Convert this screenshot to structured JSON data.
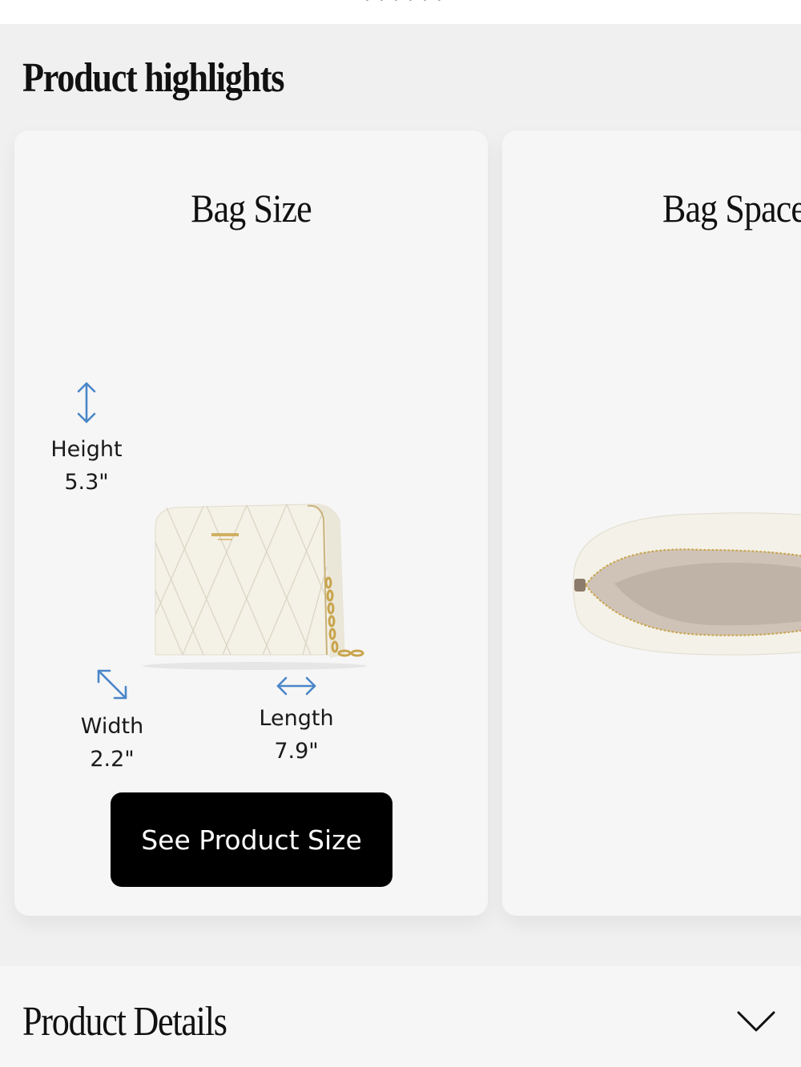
{
  "top_strip": {
    "cut_text": "· · · · · ·"
  },
  "highlights": {
    "title": "Product highlights",
    "cards": [
      {
        "title": "Bag Size",
        "height_label": "Height",
        "height_value": "5.3\"",
        "width_label": "Width",
        "width_value": "2.2\"",
        "length_label": "Length",
        "length_value": "7.9\"",
        "button_label": "See Product Size"
      },
      {
        "title": "Bag Space"
      }
    ]
  },
  "details": {
    "title": "Product Details"
  },
  "icons": {
    "height": "vertical-arrow-icon",
    "width": "diagonal-arrow-icon",
    "length": "horizontal-arrow-icon",
    "expand": "chevron-down-icon"
  },
  "colors": {
    "accent_blue": "#4a86c8",
    "button_bg": "#000000",
    "card_bg": "#f6f6f6",
    "page_bg": "#f0f0f0"
  }
}
